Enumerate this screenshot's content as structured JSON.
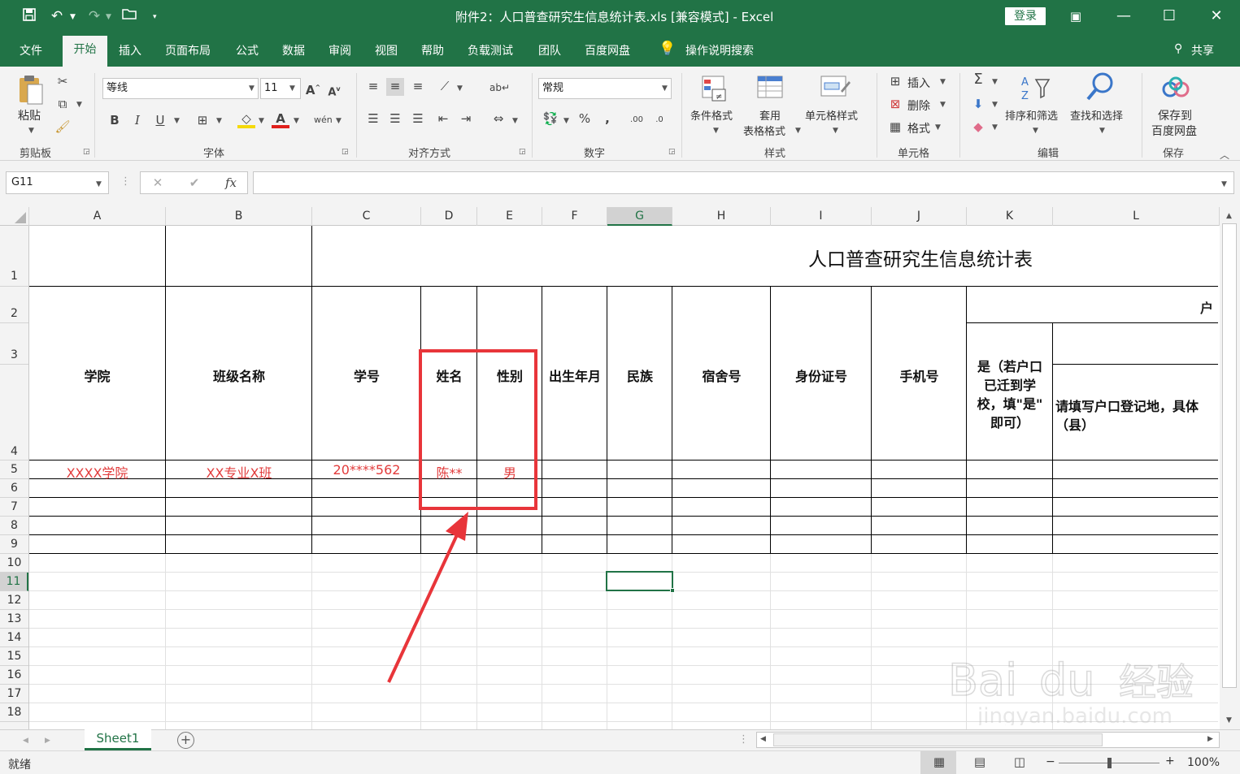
{
  "titlebar": {
    "title": "附件2：人口普查研究生信息统计表.xls  [兼容模式]  -  Excel",
    "login": "登录"
  },
  "menu": {
    "tabs": [
      "文件",
      "开始",
      "插入",
      "页面布局",
      "公式",
      "数据",
      "审阅",
      "视图",
      "帮助",
      "负载测试",
      "团队",
      "百度网盘"
    ],
    "search": "操作说明搜索",
    "share": "共享"
  },
  "ribbon": {
    "clipboard": {
      "paste": "粘贴",
      "label": "剪贴板"
    },
    "font": {
      "name": "等线",
      "size": "11",
      "label": "字体"
    },
    "align": {
      "label": "对齐方式"
    },
    "number": {
      "format": "常规",
      "label": "数字"
    },
    "styles": {
      "cond": "条件格式",
      "table1": "套用",
      "table2": "表格格式",
      "cell": "单元格样式",
      "label": "样式"
    },
    "cells": {
      "insert": "插入",
      "delete": "删除",
      "format": "格式",
      "label": "单元格"
    },
    "edit": {
      "sort": "排序和筛选",
      "find": "查找和选择",
      "label": "编辑"
    },
    "save": {
      "line1": "保存到",
      "line2": "百度网盘",
      "label": "保存"
    }
  },
  "formula": {
    "namebox": "G11",
    "fx": "fx"
  },
  "sheet": {
    "columns": [
      "A",
      "B",
      "C",
      "D",
      "E",
      "F",
      "G",
      "H",
      "I",
      "J",
      "K",
      "L"
    ],
    "rows": [
      "1",
      "2",
      "3",
      "4",
      "5",
      "6",
      "7",
      "8",
      "9",
      "10",
      "11",
      "12",
      "13",
      "14",
      "15",
      "16",
      "17",
      "18"
    ],
    "title": "人口普查研究生信息统计表",
    "headers": {
      "a": "学院",
      "b": "班级名称",
      "c": "学号",
      "d": "姓名",
      "e": "性别",
      "f": "出生年月",
      "g": "民族",
      "h": "宿舍号",
      "i": "身份证号",
      "j": "手机号",
      "k1": "是（若户口",
      "k2": "已迁到学",
      "k3": "校，填\"是\"",
      "k4": "即可）",
      "l1": "请填写户口登记地，具体",
      "l2": "（县）",
      "hukou": "户"
    },
    "record": {
      "a": "XXXX学院",
      "b": "XX专业X班",
      "c": "20****562",
      "d": "陈**",
      "e": "男"
    }
  },
  "tabs": {
    "sheet1": "Sheet1"
  },
  "status": {
    "ready": "就绪",
    "zoom": "100%"
  },
  "watermark": "Baidu经验 jingyan.baidu.com",
  "colors": {
    "excel_green": "#217346",
    "annotation_red": "#e8353a",
    "record_red": "#e23c3c"
  }
}
